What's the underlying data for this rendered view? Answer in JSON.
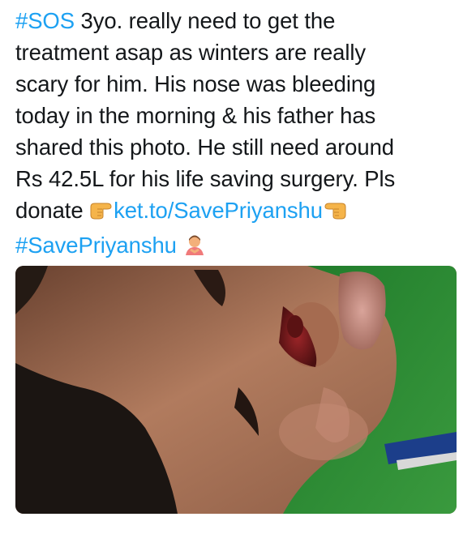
{
  "tweet": {
    "hashtag_sos": "#SOS",
    "line1_rest": " 3yo. really need to get the",
    "line2": "treatment asap as winters are really",
    "line3": "scary for him. His nose was bleeding",
    "line4": "today in the morning & his father has",
    "line5": "shared this photo. He still need around",
    "line6": "Rs 42.5L for his life saving surgery. Pls",
    "line7_prefix": "donate ",
    "link_text": "ket.to/SavePriyanshu",
    "hashtag_save": "#SavePriyanshu",
    "emoji_left": "backhand-index-pointing-right",
    "emoji_right": "backhand-index-pointing-left",
    "emoji_end": "person-bowing"
  },
  "media": {
    "description_icon": "photo-attachment",
    "colors": {
      "sweater": "#2e8a35",
      "skin": "#a8755a",
      "hair": "#1b1512",
      "blood": "#7a1a1c"
    }
  },
  "colors": {
    "link": "#1da1f2",
    "text": "#14171a"
  }
}
